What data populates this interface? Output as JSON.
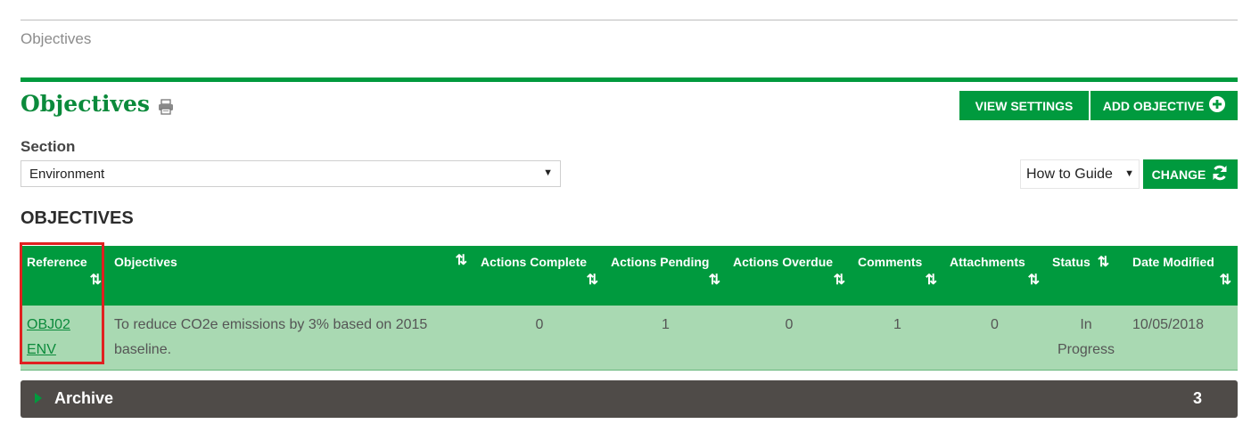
{
  "breadcrumb": "Objectives",
  "page_title": "Objectives",
  "buttons": {
    "view_settings": "VIEW SETTINGS",
    "add_objective": "ADD OBJECTIVE",
    "change": "CHANGE"
  },
  "section": {
    "label": "Section",
    "selected": "Environment"
  },
  "guide_select": "How to Guide",
  "objectives_heading": "OBJECTIVES",
  "table": {
    "headers": [
      "Reference",
      "Objectives",
      "Actions Complete",
      "Actions Pending",
      "Actions Overdue",
      "Comments",
      "Attachments",
      "Status",
      "Date Modified"
    ],
    "rows": [
      {
        "reference": "OBJ02 ENV",
        "objective": "To reduce CO2e emissions by 3% based on 2015 baseline.",
        "actions_complete": "0",
        "actions_pending": "1",
        "actions_overdue": "0",
        "comments": "1",
        "attachments": "0",
        "status": "In Progress",
        "date_modified": "10/05/2018"
      }
    ]
  },
  "archive": {
    "label": "Archive",
    "count": "3"
  },
  "colors": {
    "brand_green": "#009a3e",
    "row_green": "#a9d9b2",
    "archive_bg": "#4f4b48",
    "highlight_red": "#e02020"
  },
  "icons": [
    "print-icon",
    "plus-circle-icon",
    "refresh-icon",
    "sort-icon",
    "triangle-right-icon"
  ]
}
